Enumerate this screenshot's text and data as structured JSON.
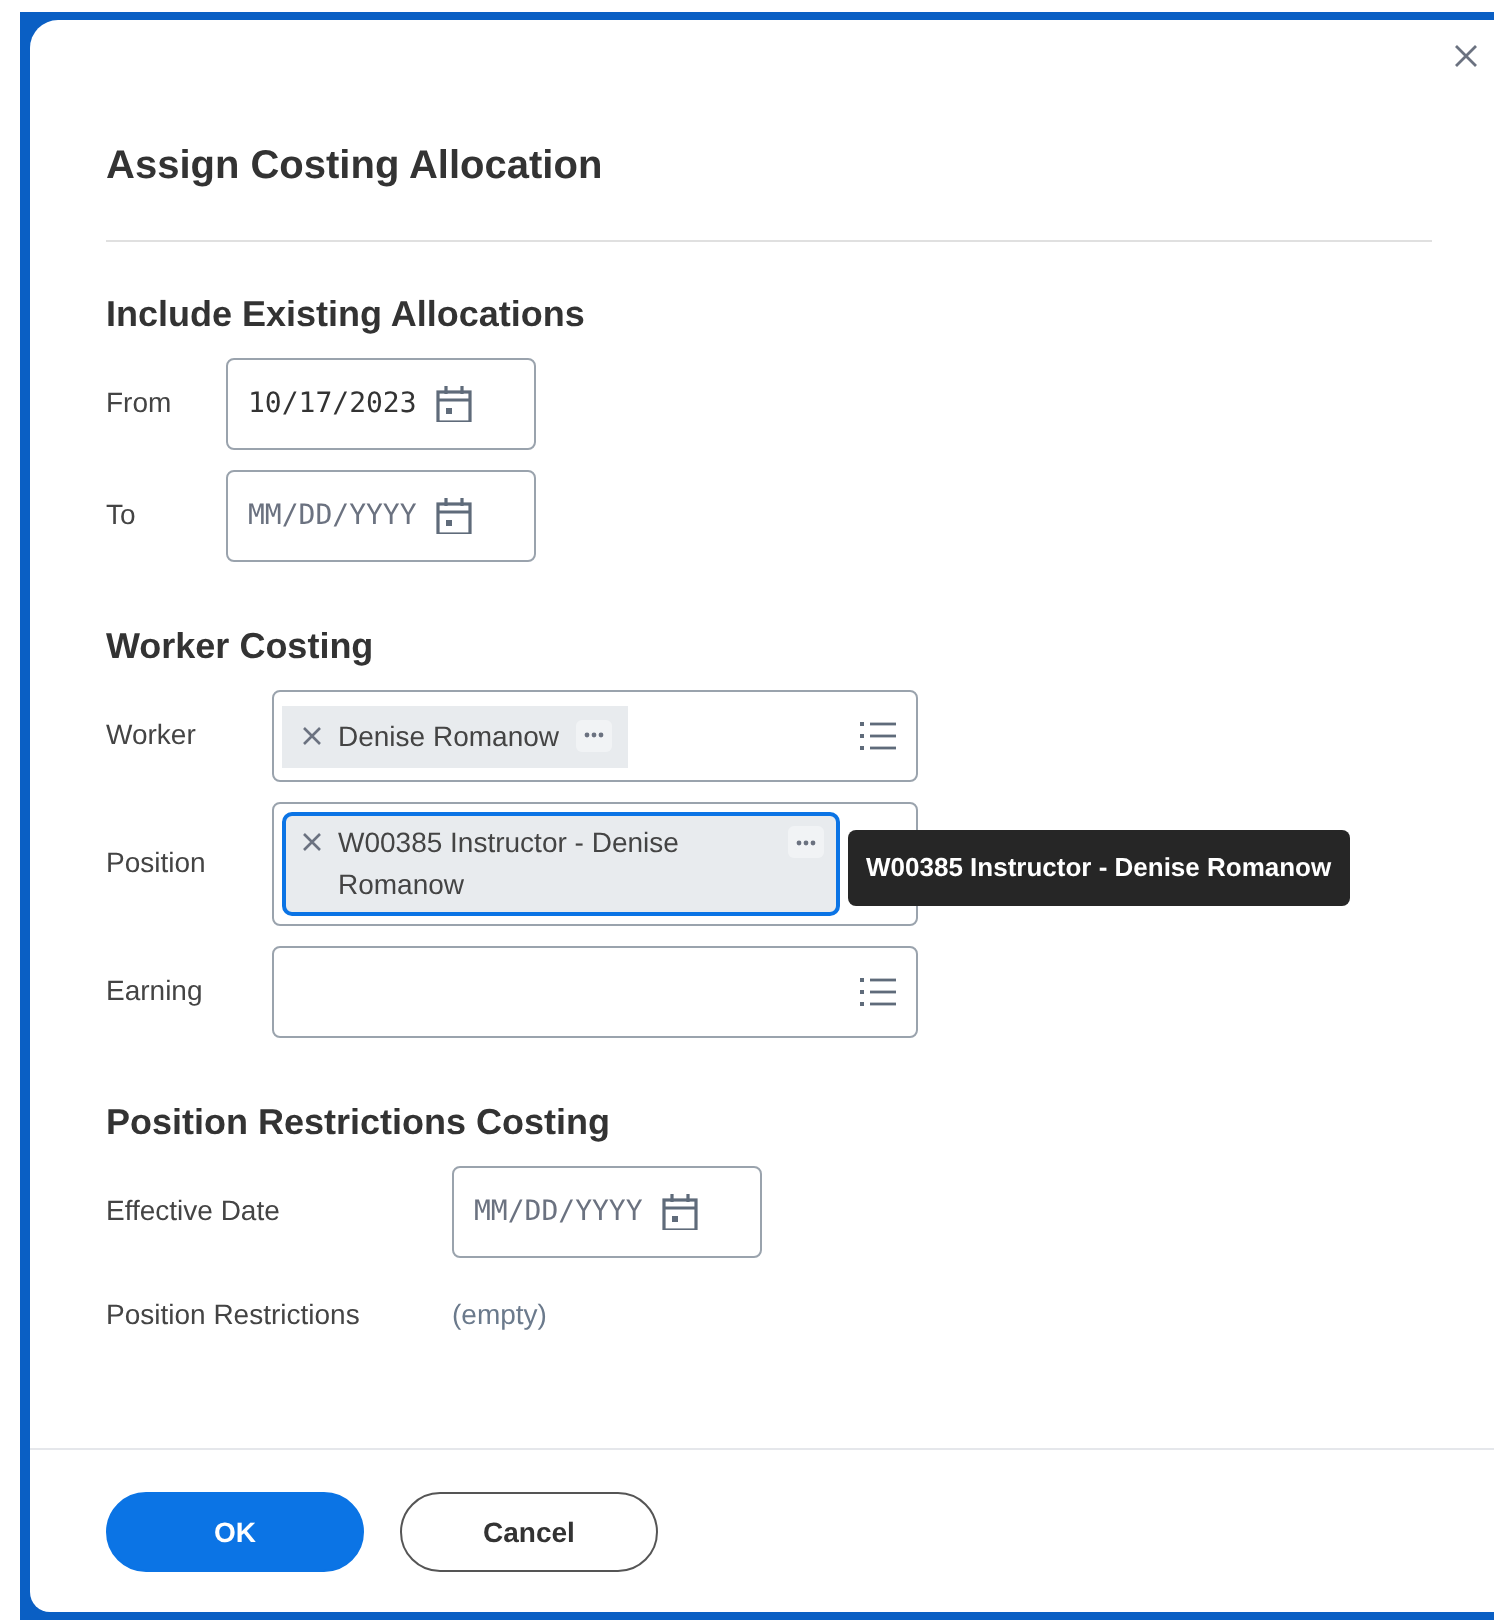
{
  "dialog": {
    "title": "Assign Costing Allocation",
    "sections": [
      {
        "title": "Include Existing Allocations",
        "fields": [
          {
            "kind": "date",
            "label": "From",
            "value": "10/17/2023"
          },
          {
            "kind": "date",
            "label": "To",
            "placeholder": "MM/DD/YYYY"
          }
        ]
      },
      {
        "title": "Worker Costing",
        "fields": [
          {
            "kind": "prompt",
            "label": "Worker",
            "chips": [
              {
                "text": "Denise Romanow",
                "focused": false
              }
            ]
          },
          {
            "kind": "prompt",
            "label": "Position",
            "chips": [
              {
                "text": "W00385 Instructor - Denise Romanow",
                "focused": true
              }
            ],
            "tooltip": "W00385 Instructor - Denise Romanow"
          },
          {
            "kind": "prompt",
            "label": "Earning"
          }
        ]
      },
      {
        "title": "Position Restrictions Costing",
        "fields": [
          {
            "kind": "date",
            "label": "Effective Date",
            "placeholder": "MM/DD/YYYY"
          },
          {
            "kind": "text",
            "label": "Position Restrictions",
            "value": "(empty)"
          }
        ]
      }
    ],
    "buttons": [
      {
        "kind": "primary",
        "label": "OK"
      },
      {
        "kind": "secondary",
        "label": "Cancel"
      }
    ]
  }
}
